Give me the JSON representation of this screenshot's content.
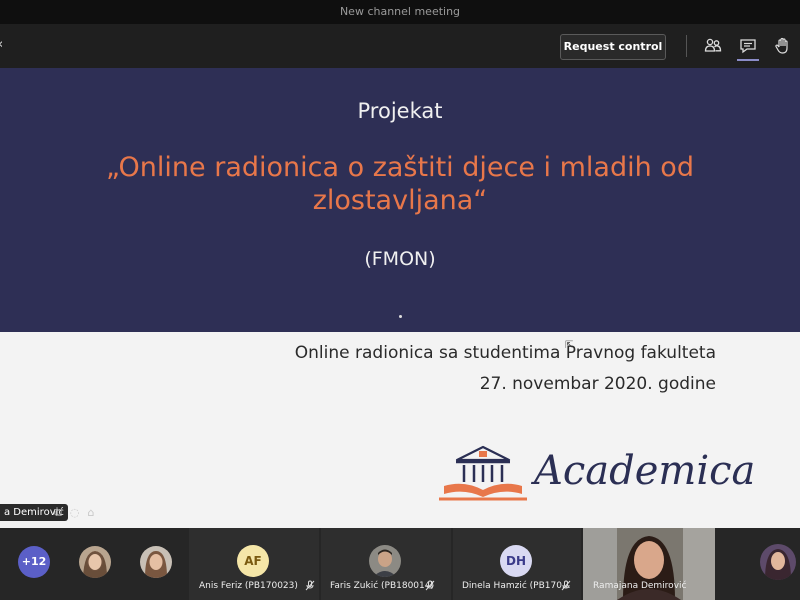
{
  "window": {
    "title": "New channel meeting"
  },
  "toolbar": {
    "back_icon": "chevron-left-icon",
    "request_control_label": "Request control",
    "icons": [
      "people-icon",
      "chat-icon",
      "raise-hand-icon"
    ]
  },
  "slide": {
    "heading": "Projekat",
    "title_line1": "„Online radionica o zaštiti djece i mladih od",
    "title_line2": "zlostavljana“",
    "org": "(FMON)",
    "subtitle_line1": "Online radionica sa studentima Pravnog fakulteta",
    "subtitle_line2": "27. novembar 2020. godine",
    "logo_text": "Academica",
    "colors": {
      "top_bg": "#2e2f55",
      "title": "#e8774a",
      "logo": "#2b2f54"
    }
  },
  "presenter_tag": "a Demirović",
  "participants": {
    "overflow_count": "+12",
    "tiles": [
      {
        "name": "Anis Feriz (PB170023)",
        "initials": "AF",
        "muted": true
      },
      {
        "name": "Faris Zukić (PB180014)",
        "initials": "",
        "muted": true
      },
      {
        "name": "Dinela Hamzić (PB170...",
        "initials": "DH",
        "muted": true
      },
      {
        "name": "Ramajana Demirović",
        "initials": "",
        "muted": false
      }
    ]
  }
}
